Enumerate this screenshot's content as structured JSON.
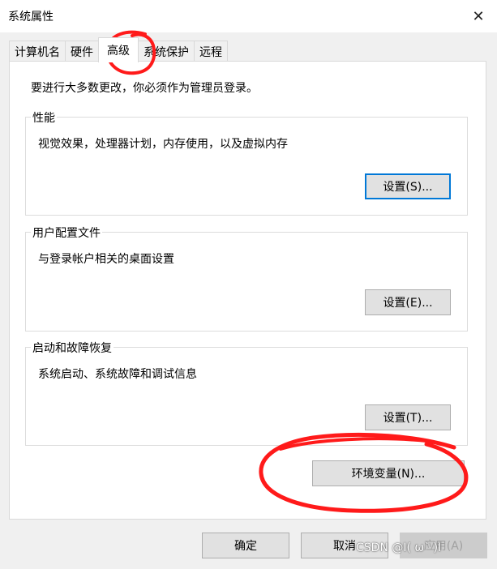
{
  "window": {
    "title": "系统属性",
    "close_glyph": "✕"
  },
  "tabs": [
    {
      "label": "计算机名"
    },
    {
      "label": "硬件"
    },
    {
      "label": "高级"
    },
    {
      "label": "系统保护"
    },
    {
      "label": "远程"
    }
  ],
  "active_tab": "高级",
  "panel": {
    "notice": "要进行大多数更改，你必须作为管理员登录。",
    "groups": [
      {
        "legend": "性能",
        "description": "视觉效果，处理器计划，内存使用，以及虚拟内存",
        "button": "设置(S)..."
      },
      {
        "legend": "用户配置文件",
        "description": "与登录帐户相关的桌面设置",
        "button": "设置(E)..."
      },
      {
        "legend": "启动和故障恢复",
        "description": "系统启动、系统故障和调试信息",
        "button": "设置(T)..."
      }
    ],
    "env_button": "环境变量(N)..."
  },
  "footer": {
    "ok": "确定",
    "cancel": "取消",
    "apply": "应用(A)"
  },
  "watermark": "CSDN @I(   ω`   )I",
  "colors": {
    "annotation_red": "#ff1a1a",
    "focus_blue": "#0078d7"
  }
}
